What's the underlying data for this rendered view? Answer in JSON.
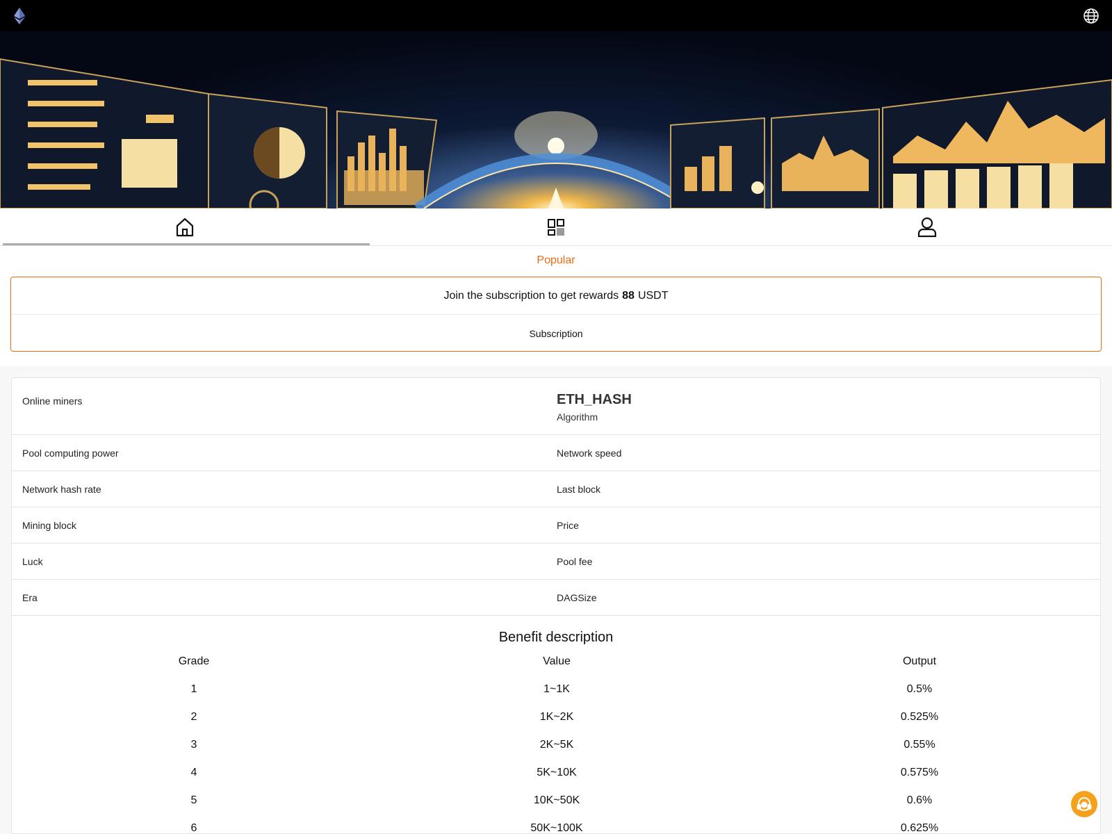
{
  "colors": {
    "accent": "#ef6a16",
    "topbar": "#000000",
    "support": "#f6a11c"
  },
  "icons": {
    "logo": "ethereum-icon",
    "language": "globe-icon",
    "tabs": [
      "home-icon",
      "apps-grid-icon",
      "user-icon"
    ],
    "support": "headset-icon"
  },
  "popular_label": "Popular",
  "subscription": {
    "text_before": "Join the subscription to get rewards",
    "reward_amount": "88",
    "text_after": "USDT",
    "button_label": "Subscription"
  },
  "stats": {
    "online_miners_label": "Online miners",
    "algorithm_name": "ETH_HASH",
    "algorithm_label": "Algorithm",
    "rows": [
      {
        "left": "Pool computing power",
        "right": "Network speed"
      },
      {
        "left": "Network hash rate",
        "right": "Last block"
      },
      {
        "left": "Mining block",
        "right": "Price"
      },
      {
        "left": "Luck",
        "right": "Pool fee"
      },
      {
        "left": "Era",
        "right": "DAGSize"
      }
    ]
  },
  "benefit": {
    "title": "Benefit description",
    "headers": [
      "Grade",
      "Value",
      "Output"
    ],
    "rows": [
      [
        "1",
        "1~1K",
        "0.5%"
      ],
      [
        "2",
        "1K~2K",
        "0.525%"
      ],
      [
        "3",
        "2K~5K",
        "0.55%"
      ],
      [
        "4",
        "5K~10K",
        "0.575%"
      ],
      [
        "5",
        "10K~50K",
        "0.6%"
      ],
      [
        "6",
        "50K~100K",
        "0.625%"
      ]
    ]
  }
}
